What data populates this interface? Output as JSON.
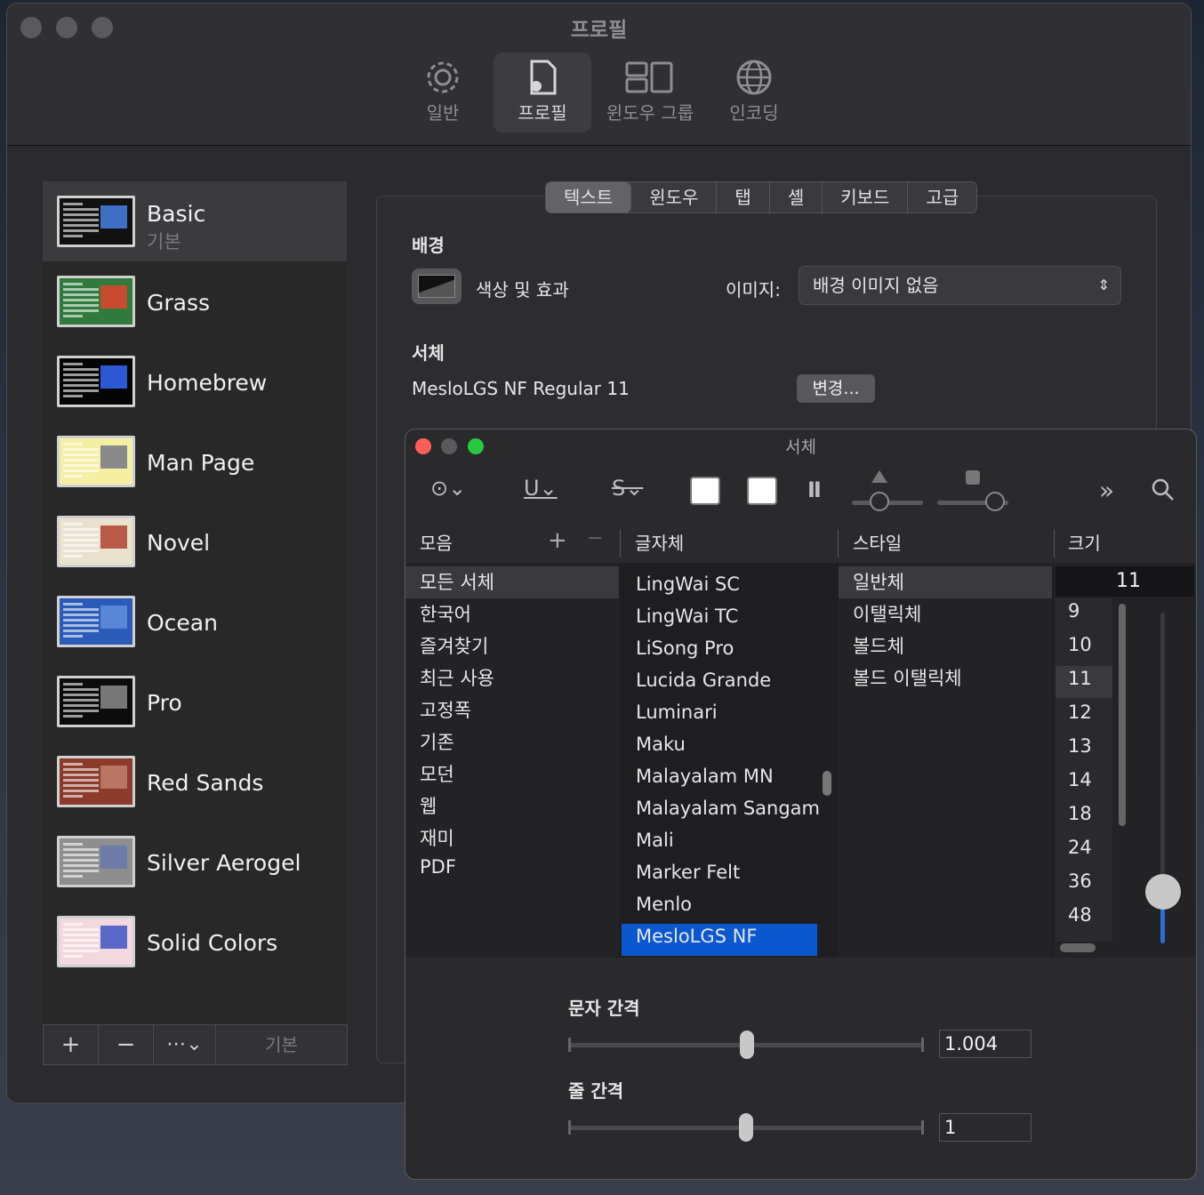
{
  "window": {
    "title": "프로필"
  },
  "toolbar": [
    {
      "label": "일반",
      "icon": "gear-icon"
    },
    {
      "label": "프로필",
      "icon": "profile-doc-icon"
    },
    {
      "label": "윈도우 그룹",
      "icon": "window-group-icon"
    },
    {
      "label": "인코딩",
      "icon": "globe-icon"
    }
  ],
  "profiles": [
    {
      "name": "Basic",
      "sub": "기본",
      "bg": "#111111",
      "accent": "#3d6fc4"
    },
    {
      "name": "Grass",
      "sub": "",
      "bg": "#2f7a3c",
      "accent": "#c84b2d"
    },
    {
      "name": "Homebrew",
      "sub": "",
      "bg": "#050505",
      "accent": "#2b58d4"
    },
    {
      "name": "Man Page",
      "sub": "",
      "bg": "#f5efa4",
      "accent": "#8a8a8a"
    },
    {
      "name": "Novel",
      "sub": "",
      "bg": "#e8e2cf",
      "accent": "#b85a47"
    },
    {
      "name": "Ocean",
      "sub": "",
      "bg": "#2b5bb8",
      "accent": "#5a86d8"
    },
    {
      "name": "Pro",
      "sub": "",
      "bg": "#0c0c0c",
      "accent": "#777777"
    },
    {
      "name": "Red Sands",
      "sub": "",
      "bg": "#8c3a2c",
      "accent": "#b87563"
    },
    {
      "name": "Silver Aerogel",
      "sub": "",
      "bg": "#8e8e8e",
      "accent": "#6e7aa8"
    },
    {
      "name": "Solid Colors",
      "sub": "",
      "bg": "#f3d9df",
      "accent": "#5a68c8"
    }
  ],
  "sidebar_bottom": {
    "add": "+",
    "remove": "−",
    "more": "⋯⌄",
    "default": "기본"
  },
  "tabs": [
    "텍스트",
    "윈도우",
    "탭",
    "셸",
    "키보드",
    "고급"
  ],
  "settings": {
    "bg_heading": "배경",
    "color_effects": "색상 및 효과",
    "image_label": "이미지:",
    "image_value": "배경 이미지 없음",
    "font_heading": "서체",
    "font_value": "MesloLGS NF Regular 11",
    "change_btn": "변경..."
  },
  "fontpanel": {
    "title": "서체",
    "col_collections": "모음",
    "col_family": "글자체",
    "col_style": "스타일",
    "col_size": "크기",
    "collections": [
      "모든 서체",
      "한국어",
      "즐겨찾기",
      "최근 사용",
      "고정폭",
      "기존",
      "모던",
      "웹",
      "재미",
      "PDF"
    ],
    "families": [
      "LingWai SC",
      "LingWai TC",
      "LiSong Pro",
      "Lucida Grande",
      "Luminari",
      "Maku",
      "Malayalam MN",
      "Malayalam Sangam",
      "Mali",
      "Marker Felt",
      "Menlo",
      "MesloLGS NF"
    ],
    "styles": [
      "일반체",
      "이탤릭체",
      "볼드체",
      "볼드 이탤릭체"
    ],
    "size_value": "11",
    "sizes": [
      "9",
      "10",
      "11",
      "12",
      "13",
      "14",
      "18",
      "24",
      "36",
      "48"
    ],
    "char_spacing_label": "문자 간격",
    "char_spacing_value": "1.004",
    "line_spacing_label": "줄 간격",
    "line_spacing_value": "1"
  }
}
